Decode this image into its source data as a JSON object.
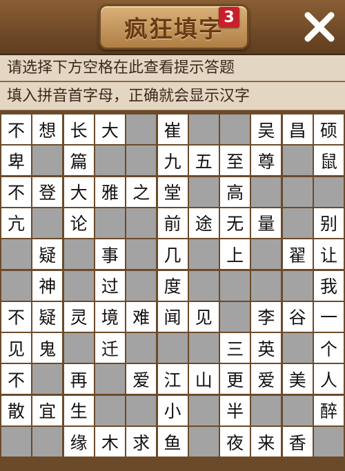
{
  "header": {
    "title": "疯狂填字",
    "badge": "3"
  },
  "hints": {
    "line1": "请选择下方空格在此查看提示答题",
    "line2": "填入拼音首字母，正确就会显示汉字"
  },
  "grid": {
    "rows": [
      [
        "不",
        "想",
        "长",
        "大",
        "#",
        "崔",
        "#",
        "#",
        "吴",
        "昌",
        "硕"
      ],
      [
        "卑",
        "#",
        "篇",
        "#",
        "#",
        "九",
        "五",
        "至",
        "尊",
        "#",
        "鼠"
      ],
      [
        "不",
        "登",
        "大",
        "雅",
        "之",
        "堂",
        "#",
        "高",
        "#",
        "#",
        "#"
      ],
      [
        "亢",
        "#",
        "论",
        "#",
        "#",
        "前",
        "途",
        "无",
        "量",
        "#",
        "别"
      ],
      [
        "#",
        "疑",
        "#",
        "事",
        "#",
        "几",
        "#",
        "上",
        "#",
        "翟",
        "让"
      ],
      [
        "#",
        "神",
        "#",
        "过",
        "#",
        "度",
        "#",
        "#",
        "#",
        "#",
        "我"
      ],
      [
        "不",
        "疑",
        "灵",
        "境",
        "难",
        "闻",
        "见",
        "#",
        "李",
        "谷",
        "一"
      ],
      [
        "见",
        "鬼",
        "#",
        "迁",
        "#",
        "#",
        "#",
        "三",
        "英",
        "#",
        "个"
      ],
      [
        "不",
        "#",
        "再",
        "#",
        "爱",
        "江",
        "山",
        "更",
        "爱",
        "美",
        "人"
      ],
      [
        "散",
        "宜",
        "生",
        "#",
        "#",
        "小",
        "#",
        "半",
        "#",
        "#",
        "醉"
      ],
      [
        "#",
        "#",
        "缘",
        "木",
        "求",
        "鱼",
        "#",
        "夜",
        "来",
        "香",
        "#"
      ]
    ]
  }
}
